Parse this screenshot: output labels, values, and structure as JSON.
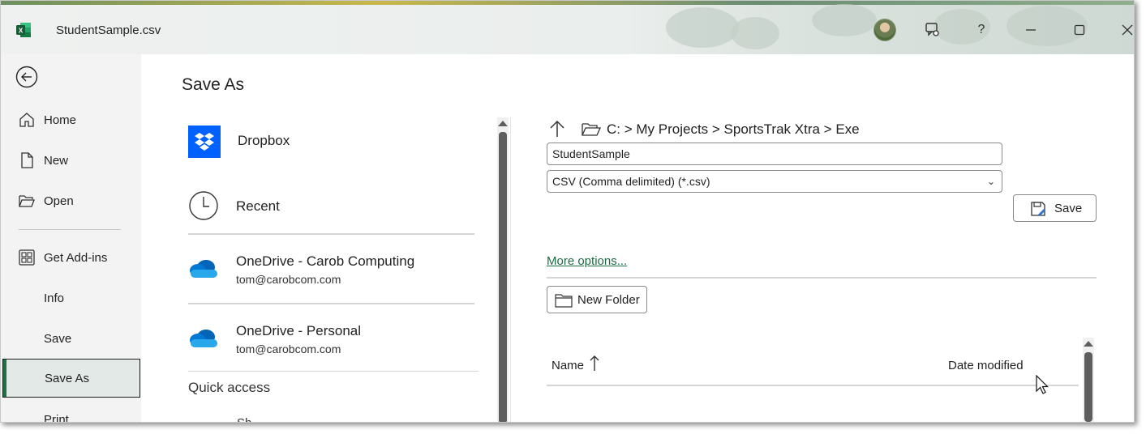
{
  "window": {
    "title": "StudentSample.csv",
    "accent_color": "#1e7145",
    "excel_logo_letter": "X"
  },
  "titlebar_buttons": [
    {
      "name": "avatar",
      "icon": "user-avatar"
    },
    {
      "name": "feedback",
      "icon": "feedback-icon"
    },
    {
      "name": "help",
      "label": "?"
    },
    {
      "name": "minimize",
      "icon": "minimize-icon"
    },
    {
      "name": "maximize",
      "icon": "maximize-icon"
    },
    {
      "name": "close",
      "icon": "close-icon"
    }
  ],
  "nav": {
    "back_icon": "back-arrow-icon",
    "items": [
      {
        "label": "Home",
        "icon": "home-icon"
      },
      {
        "label": "New",
        "icon": "new-doc-icon"
      },
      {
        "label": "Open",
        "icon": "folder-open-icon"
      },
      {
        "label": "Get Add-ins",
        "icon": "addins-grid-icon"
      },
      {
        "label": "Info"
      },
      {
        "label": "Save"
      },
      {
        "label": "Save As",
        "active": true
      },
      {
        "label": "Print"
      }
    ]
  },
  "page": {
    "title": "Save As"
  },
  "locations": [
    {
      "name": "Dropbox",
      "icon": "dropbox-icon"
    },
    {
      "name": "Recent",
      "icon": "clock-icon"
    },
    {
      "name": "OneDrive - Carob Computing",
      "sub": "tom@carobcom.com",
      "icon": "onedrive-cloud-icon"
    },
    {
      "name": "OneDrive - Personal",
      "sub": "tom@carobcom.com",
      "icon": "onedrive-cloud-icon"
    }
  ],
  "quick_access": {
    "title": "Quick access",
    "first_item_partial": "Sh"
  },
  "save_panel": {
    "path": "C: > My Projects > SportsTrak Xtra > Exe",
    "filename": "StudentSample",
    "filetype": "CSV (Comma delimited) (*.csv)",
    "save_label": "Save",
    "more_options": "More options...",
    "new_folder_label": "New Folder",
    "columns": {
      "name": "Name",
      "date_modified": "Date modified"
    }
  }
}
